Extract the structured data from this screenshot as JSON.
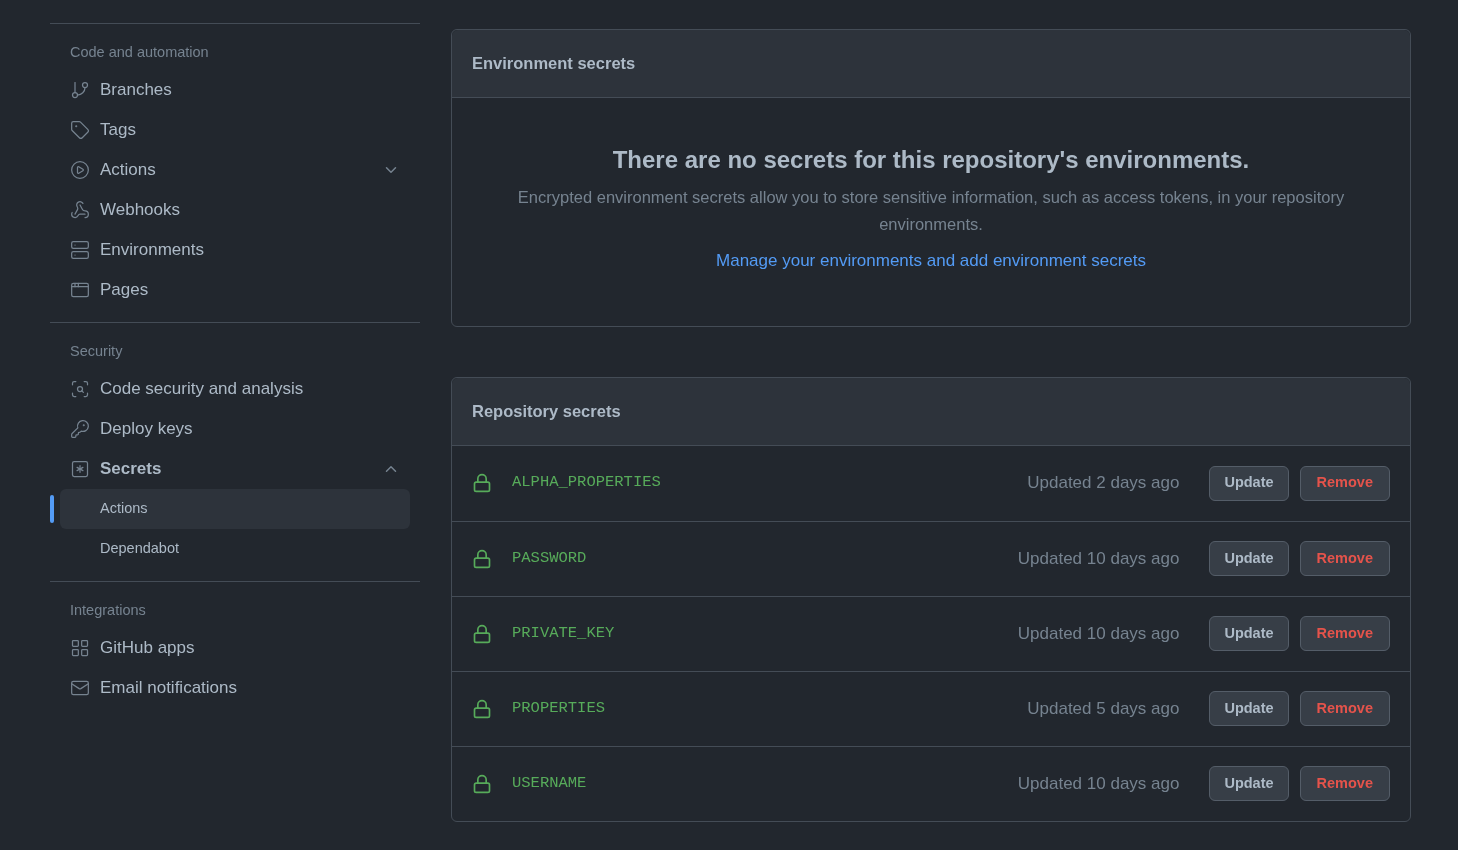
{
  "sidebar": {
    "sections": [
      {
        "heading": "Code and automation",
        "items": [
          {
            "label": "Branches"
          },
          {
            "label": "Tags"
          },
          {
            "label": "Actions",
            "expanded": false
          },
          {
            "label": "Webhooks"
          },
          {
            "label": "Environments"
          },
          {
            "label": "Pages"
          }
        ]
      },
      {
        "heading": "Security",
        "items": [
          {
            "label": "Code security and analysis"
          },
          {
            "label": "Deploy keys"
          },
          {
            "label": "Secrets",
            "expanded": true,
            "children": [
              {
                "label": "Actions",
                "selected": true
              },
              {
                "label": "Dependabot",
                "selected": false
              }
            ]
          }
        ]
      },
      {
        "heading": "Integrations",
        "items": [
          {
            "label": "GitHub apps"
          },
          {
            "label": "Email notifications"
          }
        ]
      }
    ]
  },
  "environment_secrets": {
    "title": "Environment secrets",
    "empty_title": "There are no secrets for this repository's environments.",
    "empty_text": "Encrypted environment secrets allow you to store sensitive information, such as access tokens, in your repository environments.",
    "link": "Manage your environments and add environment secrets"
  },
  "repository_secrets": {
    "title": "Repository secrets",
    "rows": [
      {
        "name": "ALPHA_PROPERTIES",
        "updated": "Updated 2 days ago",
        "update": "Update",
        "remove": "Remove"
      },
      {
        "name": "PASSWORD",
        "updated": "Updated 10 days ago",
        "update": "Update",
        "remove": "Remove"
      },
      {
        "name": "PRIVATE_KEY",
        "updated": "Updated 10 days ago",
        "update": "Update",
        "remove": "Remove"
      },
      {
        "name": "PROPERTIES",
        "updated": "Updated 5 days ago",
        "update": "Update",
        "remove": "Remove"
      },
      {
        "name": "USERNAME",
        "updated": "Updated 10 days ago",
        "update": "Update",
        "remove": "Remove"
      }
    ]
  }
}
